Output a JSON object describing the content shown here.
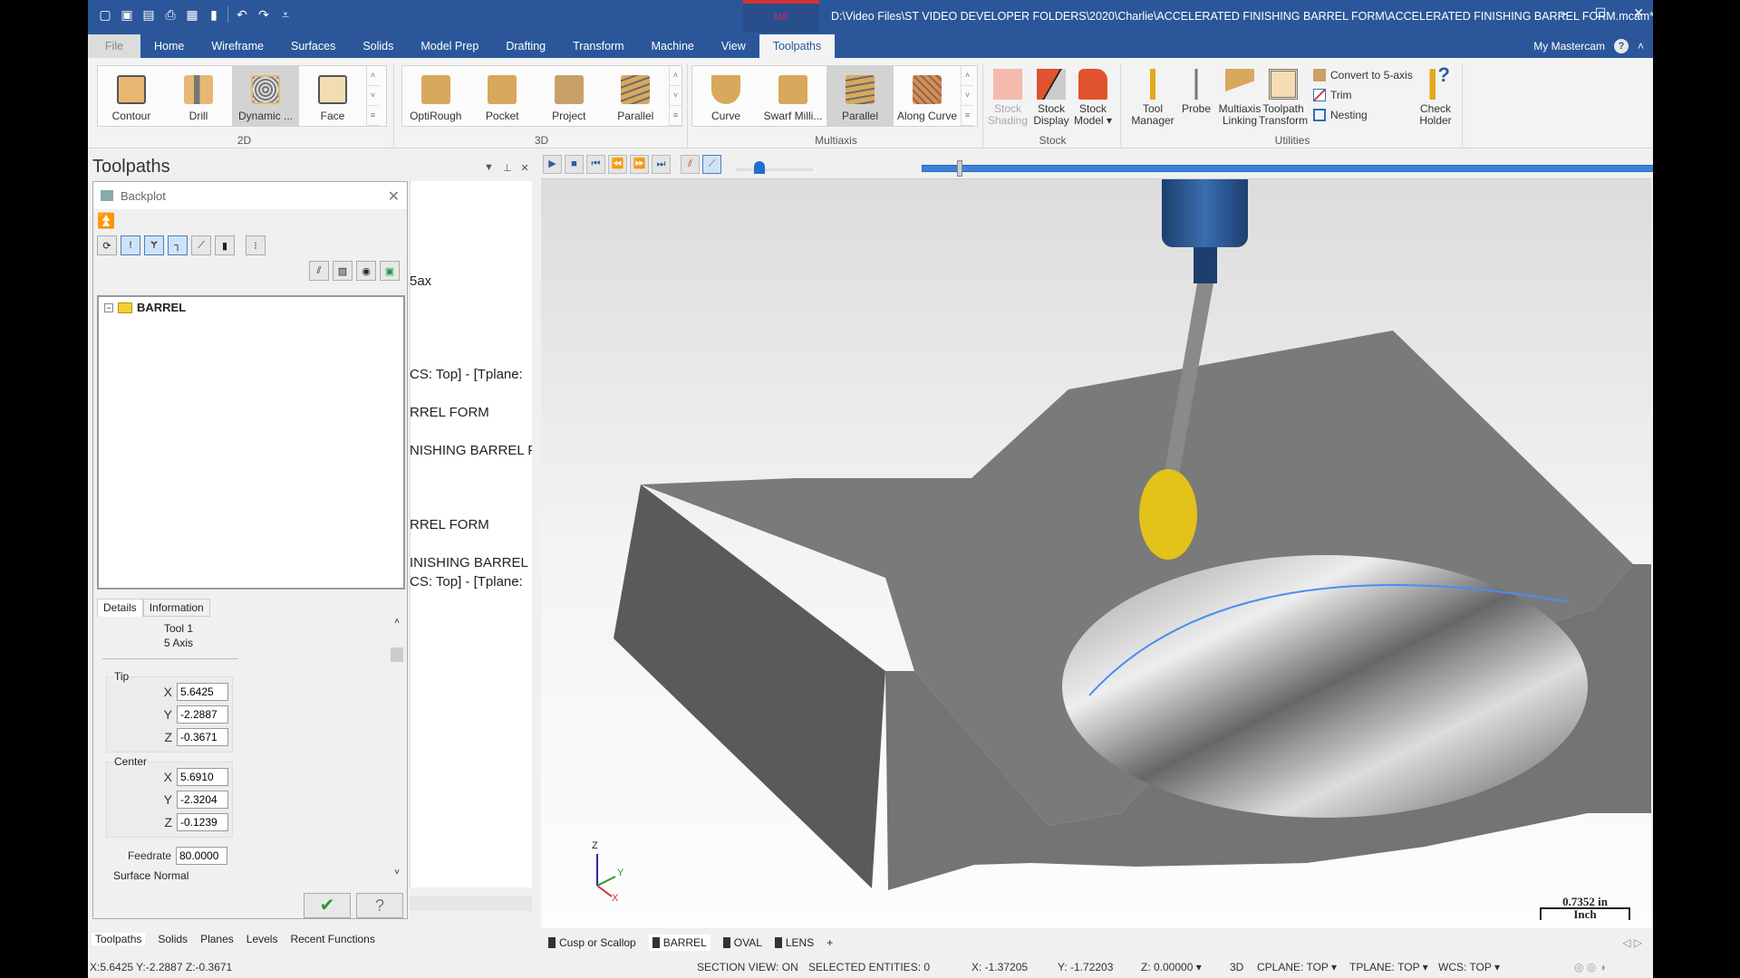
{
  "titlebar": {
    "context_tab": "Mill",
    "file_path": "D:\\Video Files\\ST VIDEO DEVELOPER FOLDERS\\2020\\Charlie\\ACCELERATED FINISHING BARREL FORM\\ACCELERATED FINISHING BARREL FORM.mcam* ...",
    "quick_access": [
      "new-file-icon",
      "save-icon",
      "open-icon",
      "print-icon",
      "save-as-icon",
      "properties-icon",
      "undo-icon",
      "redo-icon",
      "customize-icon"
    ],
    "minimize": "–",
    "maximize": "☐",
    "close": "✕"
  },
  "ribbon_tabs": [
    "File",
    "Home",
    "Wireframe",
    "Surfaces",
    "Solids",
    "Model Prep",
    "Drafting",
    "Transform",
    "Machine",
    "View",
    "Toolpaths"
  ],
  "active_tab": "Toolpaths",
  "my_mastercam": "My Mastercam",
  "ribbon": {
    "groups": {
      "g2d": {
        "label": "2D",
        "items": [
          "Contour",
          "Drill",
          "Dynamic ...",
          "Face"
        ],
        "selected": "Dynamic ..."
      },
      "g3d": {
        "label": "3D",
        "items": [
          "OptiRough",
          "Pocket",
          "Project",
          "Parallel"
        ]
      },
      "multiaxis": {
        "label": "Multiaxis",
        "items": [
          "Curve",
          "Swarf Milli...",
          "Parallel",
          "Along Curve"
        ],
        "selected": "Parallel"
      },
      "stock": {
        "label": "Stock",
        "items": [
          [
            "Stock",
            "Shading"
          ],
          [
            "Stock",
            "Display"
          ],
          [
            "Stock",
            "Model ▾"
          ]
        ]
      },
      "utilities": {
        "label": "Utilities",
        "big": [
          [
            "Tool",
            "Manager"
          ],
          [
            "Probe",
            ""
          ],
          [
            "Multiaxis",
            "Linking"
          ],
          [
            "Toolpath",
            "Transform"
          ]
        ],
        "small": [
          "Convert to 5-axis",
          "Trim",
          "Nesting"
        ],
        "check": [
          "Check",
          "Holder"
        ]
      }
    }
  },
  "left_panel": {
    "title": "Toolpaths",
    "behind_text": [
      "5ax",
      "CS: Top] - [Tplane:",
      "RREL FORM",
      "NISHING BARREL FO",
      "RREL FORM",
      "INISHING BARREL F",
      "CS: Top] - [Tplane:"
    ],
    "backplot": {
      "title": "Backplot",
      "tree_root": "BARREL",
      "tabs": [
        "Details",
        "Information"
      ],
      "active_tab": "Details",
      "tool": "Tool 1",
      "axis": "5 Axis",
      "tip": {
        "label": "Tip",
        "x": "5.6425",
        "y": "-2.2887",
        "z": "-0.3671"
      },
      "center": {
        "label": "Center",
        "x": "5.6910",
        "y": "-2.3204",
        "z": "-0.1239"
      },
      "feedrate_label": "Feedrate",
      "feedrate": "80.0000",
      "surface_normal_label": "Surface Normal",
      "ok": "✔",
      "help": "?"
    },
    "bottom_tabs": [
      "Toolpaths",
      "Solids",
      "Planes",
      "Levels",
      "Recent Functions"
    ]
  },
  "playback": {
    "progress_fraction": 0.05,
    "speed_fraction": 0.3
  },
  "viewport": {
    "scale_value": "0.7352 in",
    "scale_unit": "Inch",
    "axes": {
      "z": "Z",
      "y": "Y",
      "x": "X"
    },
    "view_tabs": [
      "Cusp or Scallop",
      "BARREL",
      "OVAL",
      "LENS"
    ],
    "add_tab": "+"
  },
  "statusbar": {
    "coords": "X:5.6425   Y:-2.2887   Z:-0.3671",
    "section_view": "SECTION VIEW: ON",
    "selected": "SELECTED ENTITIES: 0",
    "x": "X:  -1.37205",
    "y": "Y:  -1.72203",
    "z": "Z:  0.00000  ▾",
    "mode": "3D",
    "cplane": "CPLANE: TOP  ▾",
    "tplane": "TPLANE: TOP  ▾",
    "wcs": "WCS: TOP  ▾"
  },
  "colors": {
    "accent": "#2b579a",
    "tool_ball": "#e3c21a",
    "part": "#6a6a6a"
  }
}
